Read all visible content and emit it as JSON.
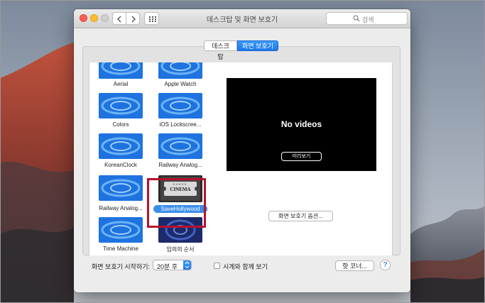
{
  "window": {
    "title": "데스크탑 및 화면 보호기",
    "search_placeholder": "검색"
  },
  "tabs": [
    {
      "label": "데스크탑",
      "active": false
    },
    {
      "label": "화면 보호기",
      "active": true
    }
  ],
  "screensavers": [
    {
      "label": "Aerial",
      "icon": "blue-swirl-thumbnail"
    },
    {
      "label": "Apple Watch",
      "icon": "blue-swirl-thumbnail"
    },
    {
      "label": "Colors",
      "icon": "blue-swirl-thumbnail"
    },
    {
      "label": "iOS Lockscree...",
      "icon": "blue-swirl-thumbnail"
    },
    {
      "label": "KoreanClock",
      "icon": "blue-swirl-thumbnail"
    },
    {
      "label": "Railway Analog...",
      "icon": "blue-swirl-thumbnail"
    },
    {
      "label": "Railway Analog...",
      "icon": "blue-swirl-thumbnail"
    },
    {
      "label": "SaveHollywood",
      "icon": "cinema-ticket-thumbnail",
      "selected": true
    },
    {
      "label": "Time Machine",
      "icon": "blue-swirl-thumbnail"
    },
    {
      "label": "임의의 순서",
      "icon": "dark-swirl-thumbnail"
    }
  ],
  "cinema_text": "CINEMA",
  "preview": {
    "message": "No videos",
    "preview_button": "미리보기",
    "options_button": "화면 보호기 옵션..."
  },
  "bottom": {
    "start_label": "화면 보호기 시작하기:",
    "start_value": "20분 후",
    "clock_label": "시계와 함께 보기",
    "clock_checked": false,
    "hot_corners_button": "핫 코너...",
    "help_button": "?"
  },
  "colors": {
    "accent": "#1b78ea",
    "highlight_box": "#b8102c",
    "selected_label_bg": "#3b8ee9"
  }
}
